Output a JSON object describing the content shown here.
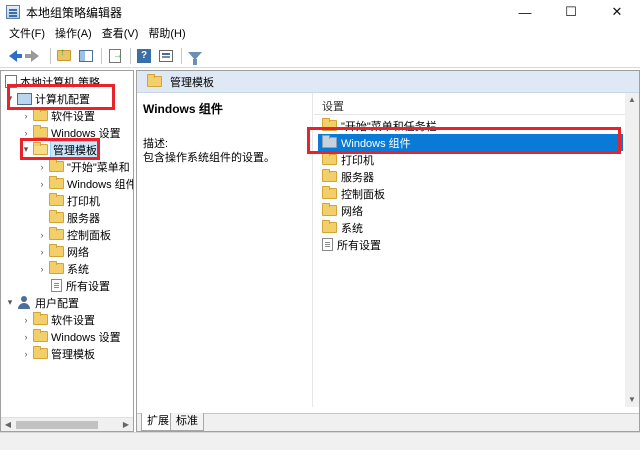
{
  "window": {
    "title": "本地组策略编辑器",
    "minimize": "—",
    "maximize": "☐",
    "close": "✕"
  },
  "menu": [
    "文件(F)",
    "操作(A)",
    "查看(V)",
    "帮助(H)"
  ],
  "toolbar": {
    "icons": [
      "back-arrow-icon",
      "forward-arrow-icon",
      "up-folder-icon",
      "show-hide-pane-icon",
      "export-list-icon",
      "help-icon",
      "properties-icon",
      "filter-icon"
    ]
  },
  "tree": {
    "root": "本地计算机 策略",
    "computer_config": "计算机配置",
    "cc_software": "软件设置",
    "cc_windows": "Windows 设置",
    "cc_admin": "管理模板",
    "admin_children": [
      "\"开始\"菜单和",
      "Windows 组件",
      "打印机",
      "服务器",
      "控制面板",
      "网络",
      "系统",
      "所有设置"
    ],
    "user_config": "用户配置",
    "uc_software": "软件设置",
    "uc_windows": "Windows 设置",
    "uc_admin": "管理模板"
  },
  "right": {
    "header": "管理模板",
    "desc_title": "Windows 组件",
    "desc_label": "描述:",
    "desc_text": "包含操作系统组件的设置。",
    "list_header": "设置",
    "items": [
      "\"开始\"菜单和任务栏",
      "Windows 组件",
      "打印机",
      "服务器",
      "控制面板",
      "网络",
      "系统",
      "所有设置"
    ],
    "selected_index": 1
  },
  "tabs": [
    "扩展",
    "标准"
  ],
  "colors": {
    "highlight": "#e8232b",
    "selection": "#0a7ad7",
    "header_bg": "#dfe9f5"
  }
}
